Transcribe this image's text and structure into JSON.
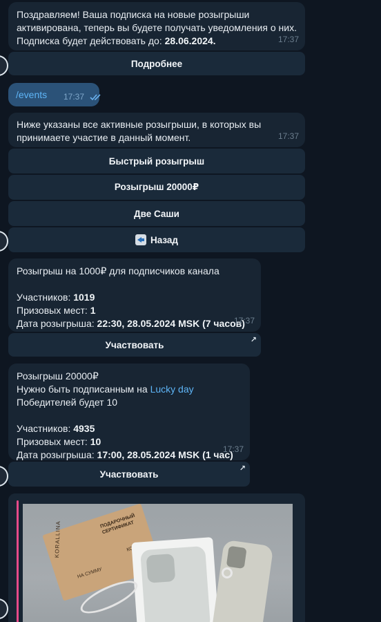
{
  "messages": {
    "m1": {
      "line1": "Поздравляем! Ваша подписка на новые розыгрыши",
      "line2": "активирована, теперь вы будете получать уведомления о них.",
      "line3_prefix": "Подписка будет действовать до: ",
      "line3_value": "28.06.2024.",
      "time": "17:37",
      "button": "Подробнее"
    },
    "out": {
      "text": "/events",
      "time": "17:37",
      "status_icon": "double-check-icon"
    },
    "m2": {
      "line1": "Ниже указаны все активные розыгрыши, в которых вы",
      "line2": "принимаете участие в данный момент.",
      "time": "17:37",
      "buttons": [
        "Быстрый розыгрыш",
        "Розыгрыш 20000₽",
        "Две Саши",
        "Назад"
      ]
    },
    "m3": {
      "title": "Розыгрыш на 1000₽ для подписчиков канала",
      "participants_label": "Участников: ",
      "participants": "1019",
      "prizes_label": "Призовых мест: ",
      "prizes": "1",
      "date_label": "Дата розыгрыша: ",
      "date": "22:30, 28.05.2024 MSK (7 часов)",
      "time": "17:37",
      "button": "Участвовать"
    },
    "m4": {
      "title": "Розыгрыш 20000₽",
      "sub_prefix": "Нужно быть подписанным на ",
      "sub_link": "Lucky day",
      "winners": "Победителей будет 10",
      "participants_label": "Участников: ",
      "participants": "4935",
      "prizes_label": "Призовых мест: ",
      "prizes": "10",
      "date_label": "Дата розыгрыша: ",
      "date": "17:00, 28.05.2024 MSK (1 час)",
      "time": "17:37",
      "button": "Участвовать"
    },
    "m5": {
      "card_brand": "KORALLINA",
      "card_label": "ПОДАРОЧНЫЙ СЕРТИФИКАТ",
      "card_amount": "НА СУММУ",
      "card_to": "КОМУ"
    }
  },
  "colors": {
    "background": "#0e1621",
    "bubble": "#182533",
    "button": "#1a2a3a",
    "outgoing": "#2b5278",
    "link": "#5eb5f7",
    "accent_bar": "#e64a8a"
  }
}
